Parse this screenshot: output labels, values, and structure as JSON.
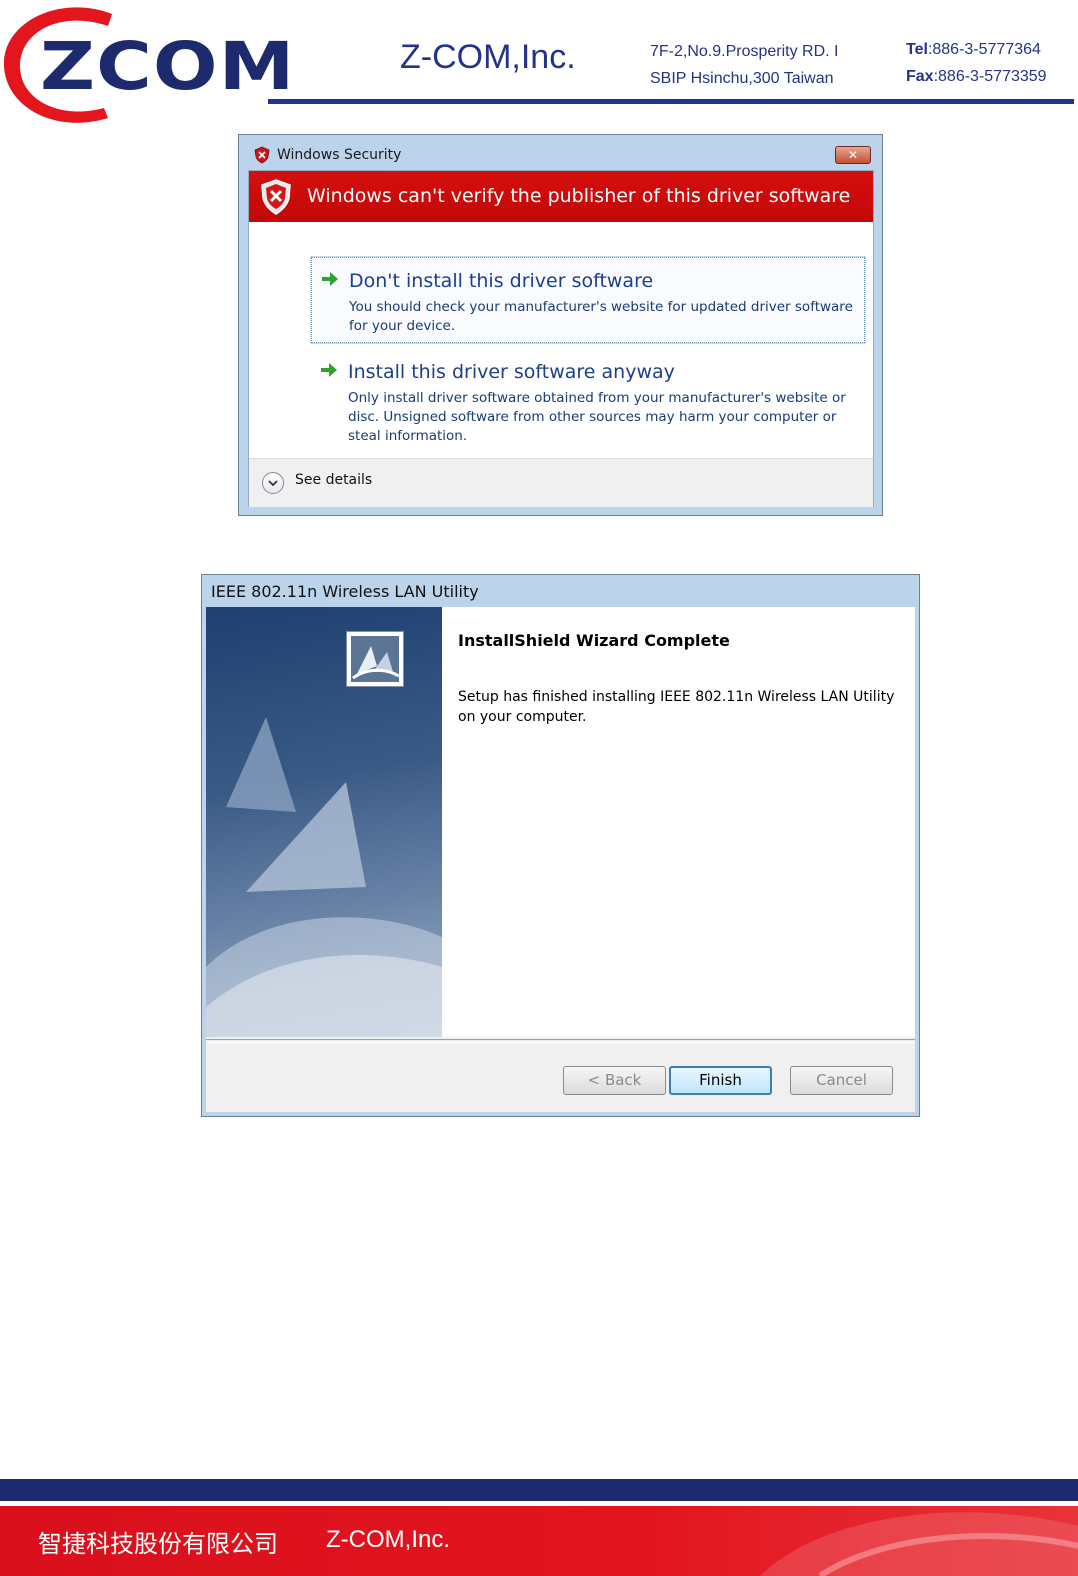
{
  "header": {
    "logo_text": "ZCOM",
    "company": "Z-COM,Inc.",
    "address_line1": "7F-2,No.9.Prosperity RD. I",
    "address_line2": "SBIP Hsinchu,300 Taiwan",
    "tel_label": "Tel",
    "tel_value": ":886-3-5777364",
    "fax_label": "Fax",
    "fax_value": ":886-3-5773359"
  },
  "security_dialog": {
    "title": "Windows Security",
    "close_label": "✕",
    "warning": "Windows can't verify the publisher of this driver software",
    "option1_title": "Don't install this driver software",
    "option1_desc": "You should check your manufacturer's website for updated driver software for your device.",
    "option2_title": "Install this driver software anyway",
    "option2_desc": "Only install driver software obtained from your manufacturer's website or disc. Unsigned software from other sources may harm your computer or steal information.",
    "details_label": "See details"
  },
  "wizard_dialog": {
    "title": "IEEE 802.11n Wireless LAN Utility",
    "heading": "InstallShield Wizard Complete",
    "message": "Setup has finished installing IEEE 802.11n Wireless LAN Utility on your computer.",
    "back_label": "< Back",
    "finish_label": "Finish",
    "cancel_label": "Cancel"
  },
  "footer": {
    "chinese_name": "智捷科技股份有限公司",
    "english_name": "Z-COM,Inc."
  },
  "colors": {
    "brand_blue": "#1d2a6e",
    "brand_red": "#d9101c",
    "warning_red": "#c20808"
  }
}
